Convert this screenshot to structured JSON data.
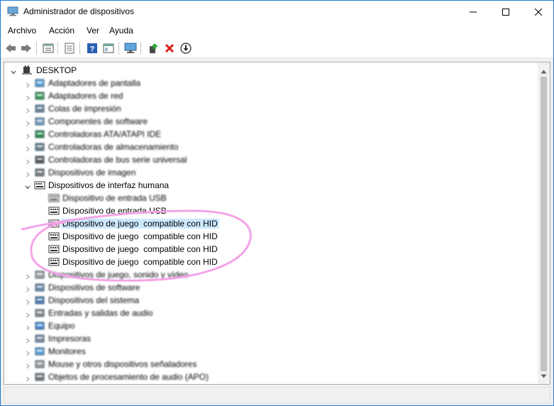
{
  "window": {
    "title": "Administrador de dispositivos"
  },
  "menubar": {
    "items": [
      "Archivo",
      "Acción",
      "Ver",
      "Ayuda"
    ]
  },
  "toolbar": {
    "icons": [
      "back-arrow-icon",
      "forward-arrow-icon",
      "properties-icon",
      "device-list-icon",
      "help-icon",
      "view-icon",
      "monitor-icon",
      "update-driver-icon",
      "uninstall-icon",
      "disable-icon"
    ]
  },
  "tree": {
    "root": "DESKTOP",
    "items": [
      {
        "label": "Adaptadores de pantalla",
        "icon": "display-adapter-icon",
        "state": "collapsed"
      },
      {
        "label": "Adaptadores de red",
        "icon": "network-adapter-icon",
        "state": "collapsed"
      },
      {
        "label": "Colas de impresión",
        "icon": "print-queue-icon",
        "state": "collapsed"
      },
      {
        "label": "Componentes de software",
        "icon": "software-component-icon",
        "state": "collapsed"
      },
      {
        "label": "Controladoras ATA/ATAPI IDE",
        "icon": "ide-controller-icon",
        "state": "collapsed"
      },
      {
        "label": "Controladoras de almacenamiento",
        "icon": "storage-controller-icon",
        "state": "collapsed"
      },
      {
        "label": "Controladoras de bus serie universal",
        "icon": "usb-controller-icon",
        "state": "collapsed"
      },
      {
        "label": "Dispositivos de imagen",
        "icon": "camera-icon",
        "state": "collapsed"
      },
      {
        "label": "Dispositivos de interfaz humana",
        "icon": "hid-icon",
        "state": "expanded"
      },
      {
        "label": "Dispositivo de entrada USB",
        "icon": "hid-device-icon",
        "child": true
      },
      {
        "label": "Dispositivo de entrada USB",
        "icon": "hid-device-icon",
        "child": true
      },
      {
        "label": "Dispositivo de juego  compatible con HID",
        "icon": "hid-device-icon",
        "child": true,
        "selected": true
      },
      {
        "label": "Dispositivo de juego  compatible con HID",
        "icon": "hid-device-icon",
        "child": true
      },
      {
        "label": "Dispositivo de juego  compatible con HID",
        "icon": "hid-device-icon",
        "child": true
      },
      {
        "label": "Dispositivo de juego  compatible con HID",
        "icon": "hid-device-icon",
        "child": true
      },
      {
        "label": "Dispositivos de juego, sonido y vídeo",
        "icon": "sound-icon",
        "state": "collapsed"
      },
      {
        "label": "Dispositivos de software",
        "icon": "software-device-icon",
        "state": "collapsed"
      },
      {
        "label": "Dispositivos del sistema",
        "icon": "system-device-icon",
        "state": "collapsed"
      },
      {
        "label": "Entradas y salidas de audio",
        "icon": "audio-io-icon",
        "state": "collapsed"
      },
      {
        "label": "Equipo",
        "icon": "computer-icon",
        "state": "collapsed"
      },
      {
        "label": "Impresoras",
        "icon": "printer-icon",
        "state": "collapsed"
      },
      {
        "label": "Monitores",
        "icon": "monitor-icon",
        "state": "collapsed"
      },
      {
        "label": "Mouse y otros dispositivos señaladores",
        "icon": "mouse-icon",
        "state": "collapsed"
      },
      {
        "label": "Objetos de procesamiento de audio (APO)",
        "icon": "apo-icon",
        "state": "collapsed"
      }
    ]
  },
  "colors": {
    "selection": "#cce8ff",
    "annotation": "#f5a3e8",
    "window_border": "#1f76d0"
  }
}
